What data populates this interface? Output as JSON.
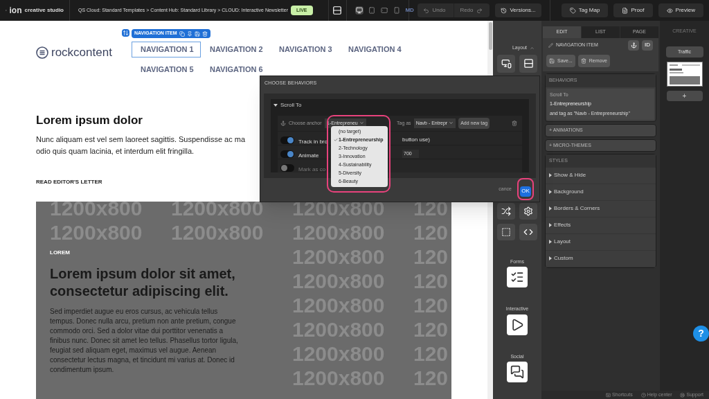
{
  "topbar": {
    "brand": "ion",
    "product": "creative studio",
    "breadcrumb": "QS Cloud: Standard Templates > Content Hub: Standard Library > CLOUD: Interactive Newsletter",
    "status": "LIVE",
    "devices": [
      {
        "kind": "desktop",
        "selected": true
      },
      {
        "kind": "tablet",
        "selected": false
      },
      {
        "kind": "landscape",
        "selected": false
      },
      {
        "kind": "phone",
        "selected": false
      }
    ],
    "breakpoint": "MD",
    "undo": "Undo",
    "redo": "Redo",
    "versions": "Versions...",
    "tag_map": "Tag Map",
    "proof": "Proof",
    "preview": "Preview"
  },
  "canvas": {
    "logo": "rockcontent",
    "selection_label": "NAVIGATION ITEM",
    "nav": [
      {
        "label": "NAVIGATION 1",
        "selected": true
      },
      {
        "label": "NAVIGATION 2",
        "selected": false
      },
      {
        "label": "NAVIGATION 3",
        "selected": false
      },
      {
        "label": "NAVIGATION 4",
        "selected": false
      },
      {
        "label": "NAVIGATION 5",
        "selected": false
      },
      {
        "label": "NAVIGATION 6",
        "selected": false
      }
    ],
    "heading": "Lorem ipsum dolor",
    "paragraph_lines": [
      "Nunc aliquam est vel sem laoreet sagittis. Suspendisse ac ma",
      "odio quis quam lacinia, et interdum elit fringilla."
    ],
    "link": "READ EDITOR'S LETTER",
    "hero": {
      "eyebrow": "LOREM",
      "title": "Lorem ipsum dolor sit amet, consectetur adipiscing elit.",
      "body": "Sed imperdiet augue eu eros cursus, ac vehicula tellus tempus. Donec nulla arcu, pretium non ante pretium, congue commodo orci. Sed a dolor vitae dui porttitor venenatis a finibus nunc. Donec sit amet leo tellus. Phasellus tortor ligula, feugiat sed aliquam eget, maximus vel augue. Aenean consectetur lectus magna, et tincidunt mi varius at. Donec id condimentum ipsum.",
      "placeholder_rows": [
        [
          "1200x800",
          "1200x800",
          "1200x800",
          "120"
        ],
        [
          "1200x800",
          "1200x800",
          "1200x800",
          "120"
        ],
        [
          "1200x800",
          "120"
        ],
        [
          "1200x800",
          "120"
        ],
        [
          "1200x800",
          "120"
        ],
        [
          "1200x800",
          "120"
        ],
        [
          "1200x800",
          "120"
        ],
        [
          "1200x800",
          "120"
        ]
      ]
    }
  },
  "tools": {
    "layout_label": "Layout",
    "sections": [
      {
        "kind": "forms",
        "label": "Forms"
      },
      {
        "kind": "interactive",
        "label": "Interactive"
      },
      {
        "kind": "social",
        "label": "Social"
      }
    ]
  },
  "dialog": {
    "title": "CHOOSE BEHAVIORS",
    "behavior": "Scroll To",
    "anchor_label": "Choose anchor",
    "anchor_value": "1-Entrepreneu",
    "tag_label": "Tag as",
    "tag_value": "Navb - Entrepr",
    "add_tag": "Add new tag",
    "toggles": [
      {
        "label": "Track in bro",
        "after": "button use)",
        "on": true
      },
      {
        "label": "Animate",
        "value": "700",
        "on": true
      },
      {
        "label": "Mark as co",
        "on": false
      }
    ],
    "options": [
      {
        "label": "(no target)",
        "selected": false
      },
      {
        "label": "1-Entrepreneurship",
        "selected": true
      },
      {
        "label": "2-Technology",
        "selected": false
      },
      {
        "label": "3-Innovation",
        "selected": false
      },
      {
        "label": "4-Sustainability",
        "selected": false
      },
      {
        "label": "5-Diversity",
        "selected": false
      },
      {
        "label": "6-Beauty",
        "selected": false
      }
    ],
    "cancel": "cance",
    "ok": "OK"
  },
  "panel": {
    "tabs": [
      {
        "label": "EDIT",
        "selected": true
      },
      {
        "label": "LIST",
        "selected": false
      },
      {
        "label": "PAGE",
        "selected": false
      }
    ],
    "element": "NAVIGATION ITEM",
    "id_button": "ID",
    "save": "Save...",
    "remove": "Remove",
    "behaviors": {
      "title": "BEHAVIORS",
      "action": "Scroll To",
      "target": "1-Entrepreneurship",
      "tag": "and tag as \"Navb - Entrepreneurship\""
    },
    "collapsed": [
      "+ ANIMATIONS",
      "+ MICRO-THEMES"
    ],
    "styles": {
      "title": "STYLES",
      "items": [
        "Show & Hide",
        "Background",
        "Borders & Corners",
        "Effects",
        "Layout",
        "Custom"
      ]
    }
  },
  "creative": {
    "title": "CREATIVE",
    "traffic": "Traffic",
    "add": "+"
  },
  "footer": [
    {
      "kind": "keyboard",
      "label": "Shortcuts"
    },
    {
      "kind": "help",
      "label": "Help center"
    },
    {
      "kind": "support",
      "label": "Support"
    }
  ],
  "help_button": "?"
}
